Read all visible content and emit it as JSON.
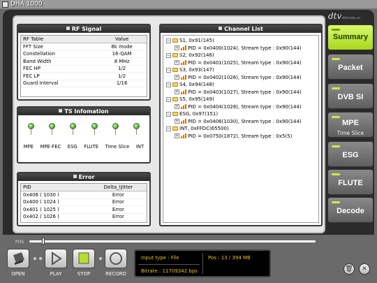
{
  "window": {
    "title": "DHA 1000"
  },
  "brand": {
    "logo": "dtv",
    "sub": "dtvcom.co"
  },
  "rf_signal": {
    "title": "RF Signal",
    "columns": [
      "RF Table",
      "Value"
    ],
    "rows": [
      [
        "FFT Size",
        "8k mode"
      ],
      [
        "Constellation",
        "16-QAM"
      ],
      [
        "Band Width",
        "8 MHz"
      ],
      [
        "FEC HP",
        "1/2"
      ],
      [
        "FEC LP",
        "1/2"
      ],
      [
        "Guard Interval",
        "1/16"
      ]
    ]
  },
  "ts_info": {
    "title": "TS Infomation",
    "leds": [
      {
        "label": "MPE",
        "color": "#42c020"
      },
      {
        "label": "MPE-FEC",
        "color": "#42c020"
      },
      {
        "label": "ESG",
        "color": "#42c020"
      },
      {
        "label": "FLUTE",
        "color": "#42c020"
      },
      {
        "label": "Time Slice",
        "color": "#42c020"
      },
      {
        "label": "INT",
        "color": "#42c020"
      }
    ]
  },
  "error": {
    "title": "Error",
    "columns": [
      "PID",
      "Delta_tJitter"
    ],
    "rows": [
      [
        "0x406 ( 1030 )",
        "Error"
      ],
      [
        "0x400 ( 1024 )",
        "Error"
      ],
      [
        "0x401 ( 1025 )",
        "Error"
      ],
      [
        "0x402 ( 1026 )",
        "Error"
      ]
    ]
  },
  "channel_list": {
    "title": "Channel List",
    "items": [
      {
        "service": "S1, 0x91(145)",
        "pid": "PID = 0x0400(1024), Stream type : 0x90(144)"
      },
      {
        "service": "S2, 0x92(146)",
        "pid": "PID = 0x0401(1025), Stream type : 0x90(144)"
      },
      {
        "service": "S3, 0x93(147)",
        "pid": "PID = 0x0402(1026), Stream type : 0x90(144)"
      },
      {
        "service": "S4, 0x94(148)",
        "pid": "PID = 0x0403(1027), Stream type : 0x90(144)"
      },
      {
        "service": "S5, 0x95(149)",
        "pid": "PID = 0x0404(1028), Stream type : 0x90(144)"
      },
      {
        "service": "ESG, 0x97(151)",
        "pid": "PID = 0x0406(1030), Stream type : 0x90(144)"
      },
      {
        "service": "INT, 0xFFDC(65500)",
        "pid": "PID = 0x0750(1872), Stream type : 0x5(5)"
      }
    ]
  },
  "nav": {
    "accent": "#c8f040",
    "items": [
      {
        "label": "Summary",
        "active": true
      },
      {
        "label": "Packet"
      },
      {
        "label": "DVB SI"
      },
      {
        "label": "MPE",
        "sub": "Time Slice"
      },
      {
        "label": "ESG"
      },
      {
        "label": "FLUTE"
      },
      {
        "label": "Decode"
      }
    ]
  },
  "controls": {
    "pos_label": "POS",
    "open": "OPEN",
    "play": "PLAY",
    "stop": "STOP",
    "record": "RECORD"
  },
  "info": {
    "input_type": "Input type : File",
    "pos": "Pos  :  13 / 394 MB",
    "bitrate": "Bitrate : 11709342 bps"
  }
}
